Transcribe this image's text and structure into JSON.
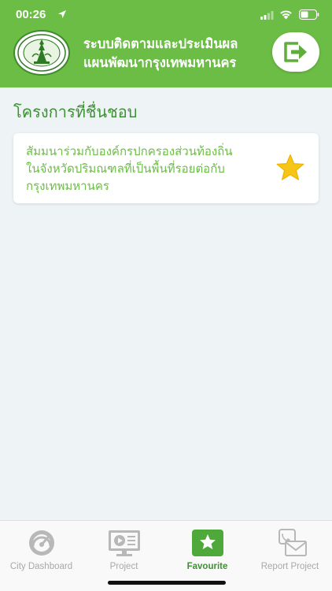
{
  "status_bar": {
    "time": "00:26",
    "location_icon": "location-arrow-icon",
    "signal_icon": "cellular-signal-icon",
    "wifi_icon": "wifi-icon",
    "battery_icon": "battery-icon"
  },
  "header": {
    "title_line1": "ระบบติดตามและประเมินผล",
    "title_line2": "แผนพัฒนากรุงเทพมหานคร",
    "logo_icon": "bangkok-emblem-logo",
    "logout_icon": "logout-icon"
  },
  "section": {
    "title": "โครงการที่ชื่นชอบ"
  },
  "favourites": [
    {
      "title_line1": "สัมมนาร่วมกับองค์กรปกครองส่วนท้องถิ่น",
      "title_line2": "ในจังหวัดปริมณฑลที่เป็นพื้นที่รอยต่อกับ",
      "title_line3": "กรุงเทพมหานคร",
      "icon": "star-icon",
      "starred": true
    }
  ],
  "tabs": [
    {
      "label": "City Dashboard",
      "icon": "gauge-icon",
      "active": false
    },
    {
      "label": "Project",
      "icon": "monitor-presentation-icon",
      "active": false
    },
    {
      "label": "Favourite",
      "icon": "star-icon",
      "active": true
    },
    {
      "label": "Report Project",
      "icon": "phone-mail-icon",
      "active": false
    }
  ],
  "colors": {
    "primary_green": "#6cbd45",
    "dark_green": "#3f8f36",
    "star_yellow": "#f5c518",
    "background": "#eef3f6",
    "inactive_tab": "#a8a8a8"
  }
}
